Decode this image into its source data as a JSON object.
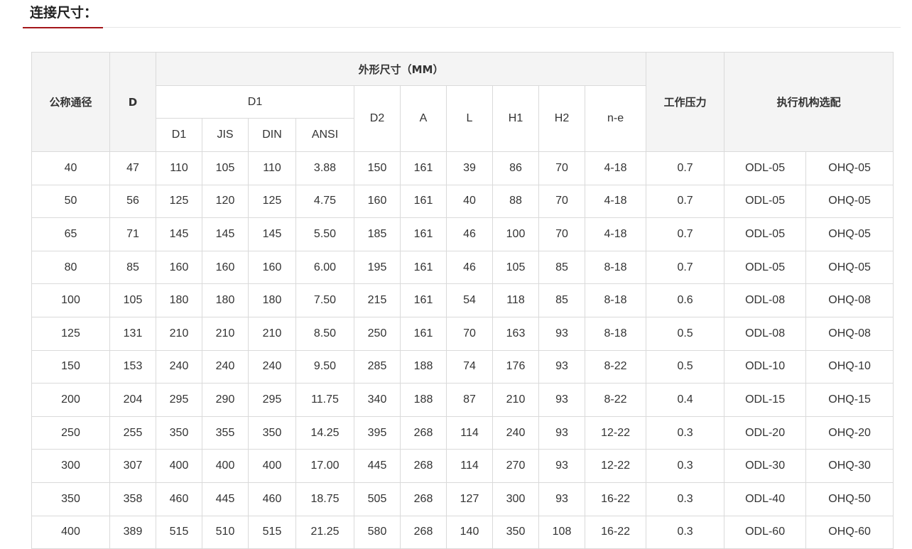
{
  "section": {
    "title": "连接尺寸：",
    "accent_color": "#a4161a"
  },
  "table": {
    "headers": {
      "nominal": "公称通径",
      "d": "D",
      "dimensions": "外形尺寸（MM）",
      "d1_group": "D1",
      "d1": "D1",
      "jis": "JIS",
      "din": "DIN",
      "ansi": "ANSI",
      "d2": "D2",
      "a": "A",
      "l": "L",
      "h1": "H1",
      "h2": "H2",
      "ne": "n-e",
      "pressure": "工作压力",
      "actuator": "执行机构选配"
    },
    "rows": [
      [
        "40",
        "47",
        "110",
        "105",
        "110",
        "3.88",
        "150",
        "161",
        "39",
        "86",
        "70",
        "4-18",
        "0.7",
        "ODL-05",
        "OHQ-05"
      ],
      [
        "50",
        "56",
        "125",
        "120",
        "125",
        "4.75",
        "160",
        "161",
        "40",
        "88",
        "70",
        "4-18",
        "0.7",
        "ODL-05",
        "OHQ-05"
      ],
      [
        "65",
        "71",
        "145",
        "145",
        "145",
        "5.50",
        "185",
        "161",
        "46",
        "100",
        "70",
        "4-18",
        "0.7",
        "ODL-05",
        "OHQ-05"
      ],
      [
        "80",
        "85",
        "160",
        "160",
        "160",
        "6.00",
        "195",
        "161",
        "46",
        "105",
        "85",
        "8-18",
        "0.7",
        "ODL-05",
        "OHQ-05"
      ],
      [
        "100",
        "105",
        "180",
        "180",
        "180",
        "7.50",
        "215",
        "161",
        "54",
        "118",
        "85",
        "8-18",
        "0.6",
        "ODL-08",
        "OHQ-08"
      ],
      [
        "125",
        "131",
        "210",
        "210",
        "210",
        "8.50",
        "250",
        "161",
        "70",
        "163",
        "93",
        "8-18",
        "0.5",
        "ODL-08",
        "OHQ-08"
      ],
      [
        "150",
        "153",
        "240",
        "240",
        "240",
        "9.50",
        "285",
        "188",
        "74",
        "176",
        "93",
        "8-22",
        "0.5",
        "ODL-10",
        "OHQ-10"
      ],
      [
        "200",
        "204",
        "295",
        "290",
        "295",
        "11.75",
        "340",
        "188",
        "87",
        "210",
        "93",
        "8-22",
        "0.4",
        "ODL-15",
        "OHQ-15"
      ],
      [
        "250",
        "255",
        "350",
        "355",
        "350",
        "14.25",
        "395",
        "268",
        "114",
        "240",
        "93",
        "12-22",
        "0.3",
        "ODL-20",
        "OHQ-20"
      ],
      [
        "300",
        "307",
        "400",
        "400",
        "400",
        "17.00",
        "445",
        "268",
        "114",
        "270",
        "93",
        "12-22",
        "0.3",
        "ODL-30",
        "OHQ-30"
      ],
      [
        "350",
        "358",
        "460",
        "445",
        "460",
        "18.75",
        "505",
        "268",
        "127",
        "300",
        "93",
        "16-22",
        "0.3",
        "ODL-40",
        "OHQ-50"
      ],
      [
        "400",
        "389",
        "515",
        "510",
        "515",
        "21.25",
        "580",
        "268",
        "140",
        "350",
        "108",
        "16-22",
        "0.3",
        "ODL-60",
        "OHQ-60"
      ]
    ]
  }
}
